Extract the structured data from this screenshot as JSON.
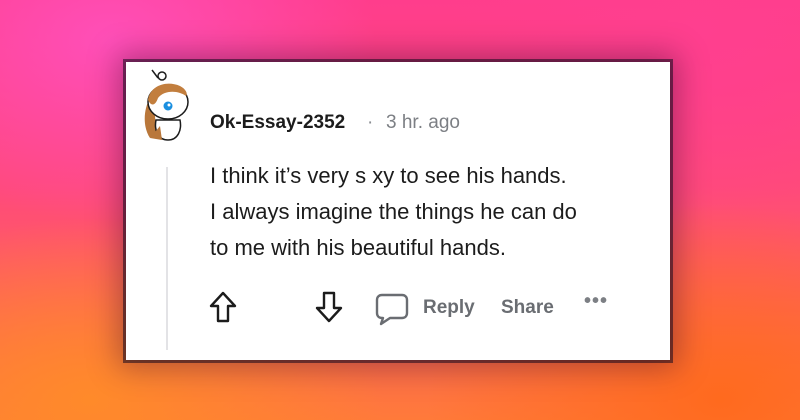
{
  "comment": {
    "username": "Ok-Essay-2352",
    "separator": "·",
    "timestamp": "3 hr. ago",
    "lines": [
      "I think it’s very s   xy to see his hands.",
      "I always imagine the things he can do",
      "to me with his beautiful hands."
    ]
  },
  "actions": {
    "upvote_icon": "arrow-up-outline-icon",
    "downvote_icon": "arrow-down-outline-icon",
    "comment_icon": "speech-bubble-icon",
    "reply_label": "Reply",
    "share_label": "Share",
    "more_icon": "•••"
  },
  "colors": {
    "username": "#1c1c1c",
    "meta": "#7c7f84",
    "action": "#6a6d72",
    "card": "#ffffff"
  }
}
